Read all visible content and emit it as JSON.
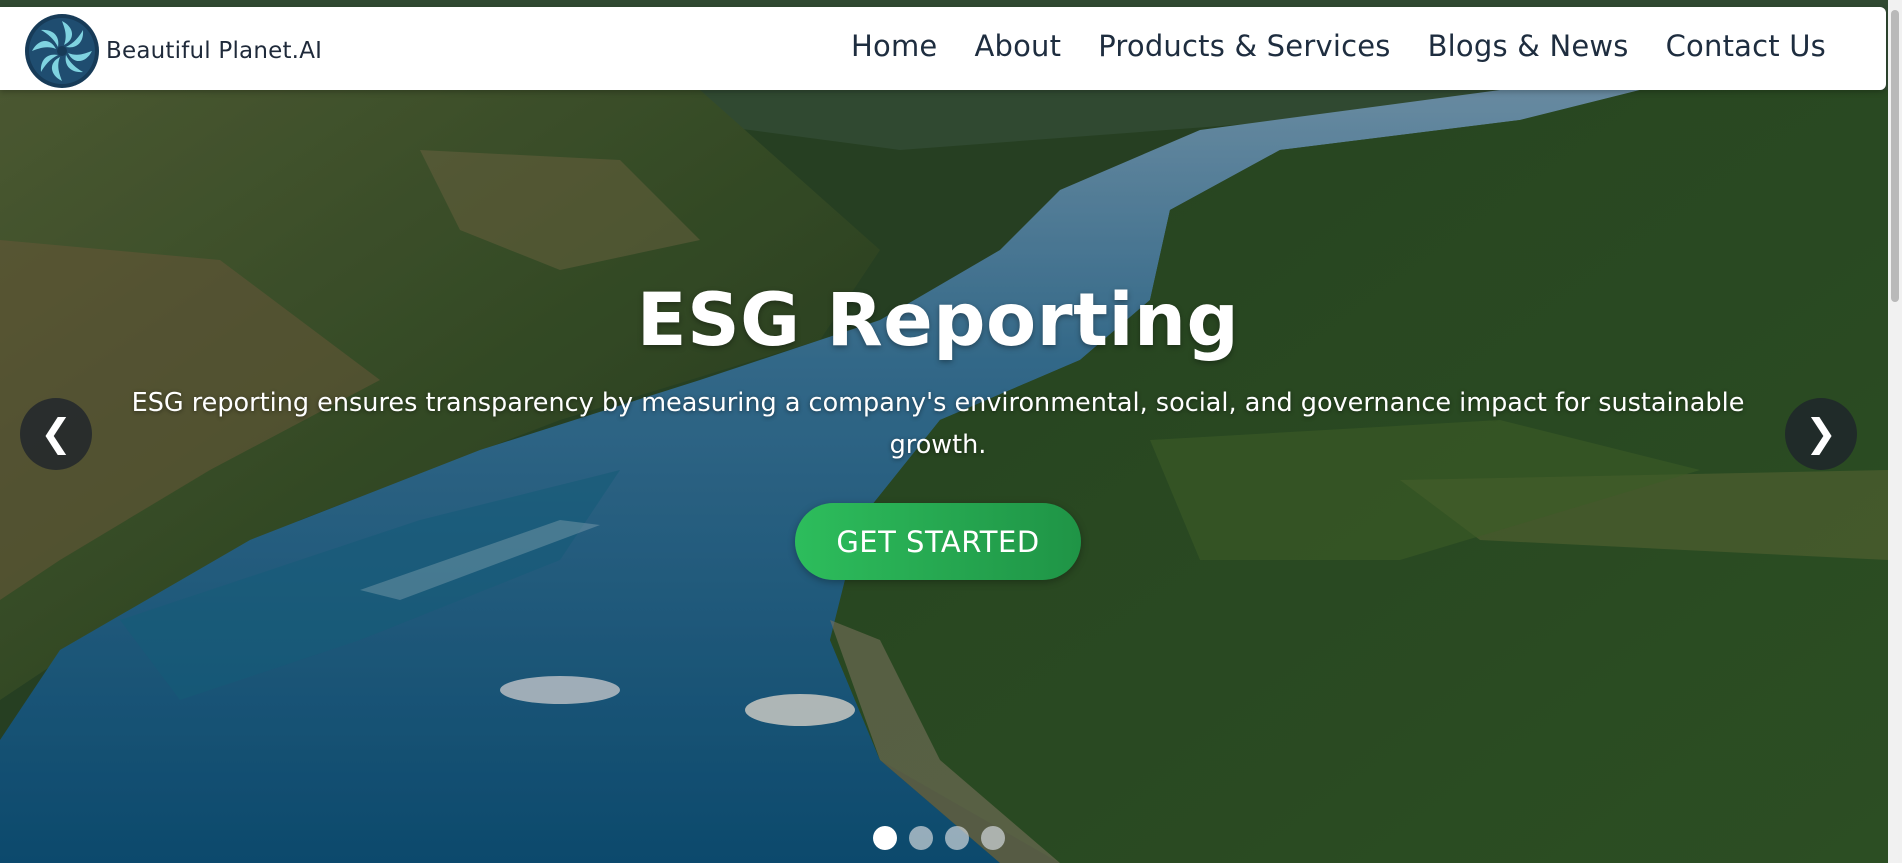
{
  "brand": {
    "name": "Beautiful Planet.AI",
    "logo_icon": "swirl-logo-icon",
    "colors": {
      "logo_dark": "#173b58",
      "logo_light": "#7fd3e0"
    }
  },
  "nav": {
    "items": [
      {
        "label": "Home"
      },
      {
        "label": "About"
      },
      {
        "label": "Products & Services"
      },
      {
        "label": "Blogs & News"
      },
      {
        "label": "Contact Us"
      }
    ]
  },
  "hero": {
    "title": "ESG Reporting",
    "description": "ESG reporting ensures transparency by measuring a company's environmental, social, and governance impact for sustainable growth.",
    "cta_label": "GET STARTED",
    "prev_icon": "❮",
    "next_icon": "❯",
    "slides": {
      "count": 4,
      "active": 1
    },
    "colors": {
      "cta": "#2aae55",
      "text": "#ffffff"
    }
  }
}
